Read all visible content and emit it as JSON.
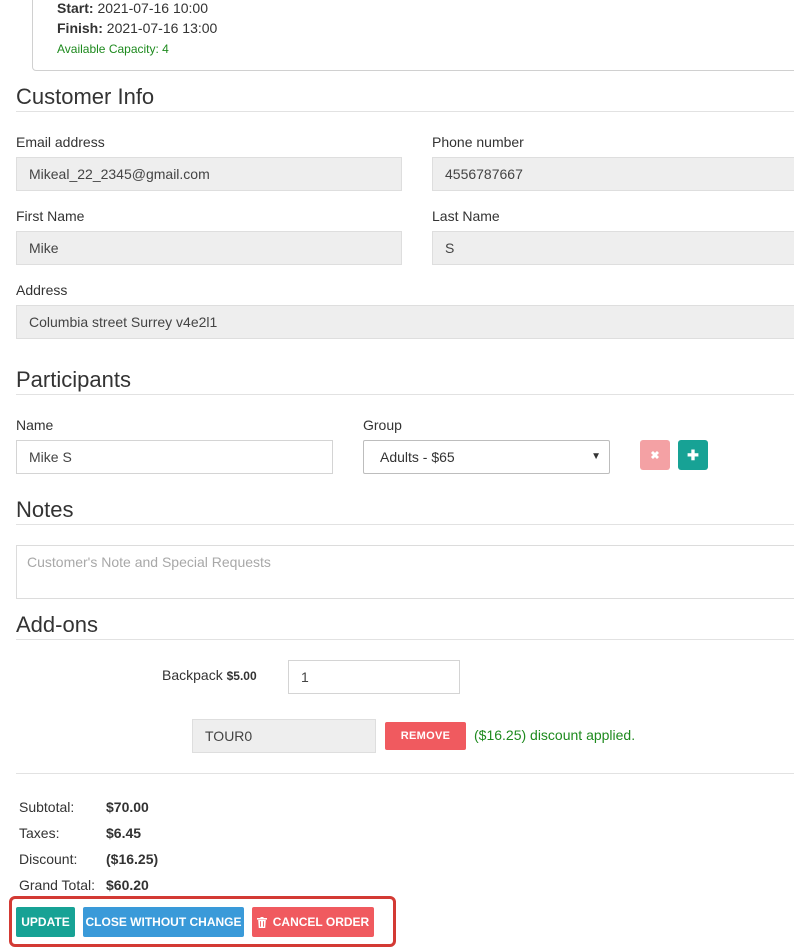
{
  "slot": {
    "start_label": "Start:",
    "start_value": "2021-07-16 10:00",
    "finish_label": "Finish:",
    "finish_value": "2021-07-16 13:00",
    "capacity": "Available Capacity: 4"
  },
  "customer": {
    "title": "Customer Info",
    "email_label": "Email address",
    "email_value": "Mikeal_22_2345@gmail.com",
    "phone_label": "Phone number",
    "phone_value": "4556787667",
    "first_label": "First Name",
    "first_value": "Mike",
    "last_label": "Last Name",
    "last_value": "S",
    "address_label": "Address",
    "address_value": "Columbia street Surrey v4e2l1"
  },
  "participants": {
    "title": "Participants",
    "name_label": "Name",
    "group_label": "Group",
    "rows": [
      {
        "name": "Mike S",
        "group": "Adults - $65"
      }
    ],
    "remove_icon": "✖",
    "add_icon": "✚"
  },
  "notes": {
    "title": "Notes",
    "placeholder": "Customer's Note and Special Requests"
  },
  "addons": {
    "title": "Add-ons",
    "backpack_label": "Backpack",
    "backpack_price": "$5.00",
    "backpack_qty": "1",
    "coupon_code": "TOUR0",
    "remove_label": "REMOVE",
    "discount_message": "($16.25) discount applied."
  },
  "totals": {
    "subtotal_label": "Subtotal:",
    "subtotal_value": "$70.00",
    "taxes_label": "Taxes:",
    "taxes_value": "$6.45",
    "discount_label": "Discount:",
    "discount_value": "($16.25)",
    "grand_label": "Grand Total:",
    "grand_value": "$60.20"
  },
  "actions": {
    "update": "UPDATE",
    "close": "CLOSE WITHOUT CHANGE",
    "cancel": "CANCEL ORDER",
    "cancel_icon": "trash-icon"
  },
  "colors": {
    "teal": "#17a295",
    "blue": "#3a9ad9",
    "red": "#f05a5f",
    "pink": "#f4a1a4",
    "green_text": "#1e8a1e",
    "highlight": "#d33a34"
  }
}
